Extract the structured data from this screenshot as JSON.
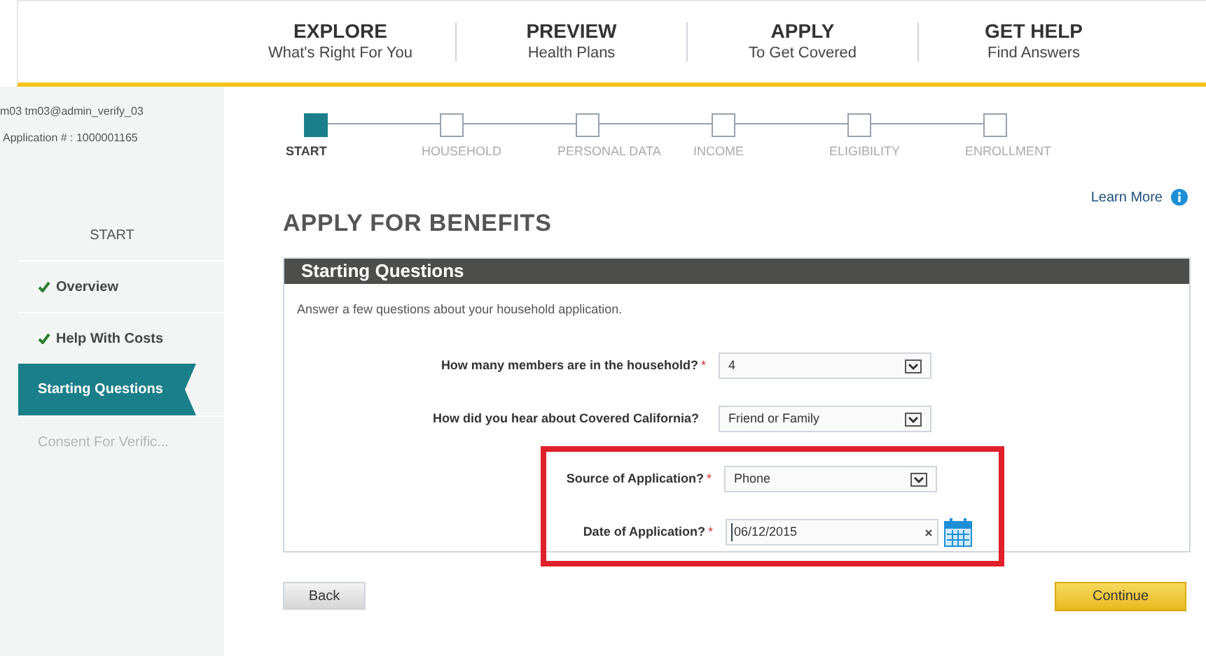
{
  "nav": [
    {
      "title": "EXPLORE",
      "subtitle": "What's Right For You"
    },
    {
      "title": "PREVIEW",
      "subtitle": "Health Plans"
    },
    {
      "title": "APPLY",
      "subtitle": "To Get Covered"
    },
    {
      "title": "GET HELP",
      "subtitle": "Find Answers"
    }
  ],
  "user": {
    "name": "m03 tm03@admin_verify_03",
    "application": "Application # : 1000001165"
  },
  "sidebar": {
    "heading": "START",
    "items": [
      {
        "label": "Overview",
        "completed": true,
        "selected": false,
        "disabled": false
      },
      {
        "label": "Help With Costs",
        "completed": true,
        "selected": false,
        "disabled": false
      },
      {
        "label": "Starting Questions",
        "completed": false,
        "selected": true,
        "disabled": false
      },
      {
        "label": "Consent For Verific...",
        "completed": false,
        "selected": false,
        "disabled": true
      }
    ]
  },
  "steps": [
    {
      "label": "START",
      "selected": true
    },
    {
      "label": "HOUSEHOLD",
      "selected": false
    },
    {
      "label": "PERSONAL DATA",
      "selected": false
    },
    {
      "label": "INCOME",
      "selected": false
    },
    {
      "label": "ELIGIBILITY",
      "selected": false
    },
    {
      "label": "ENROLLMENT",
      "selected": false
    }
  ],
  "learn_more": "Learn More",
  "title": "APPLY FOR BENEFITS",
  "panel": {
    "heading": "Starting Questions",
    "intro": "Answer a few questions about your household application.",
    "questions": [
      {
        "kind": "select",
        "label": "How many members are in the household?",
        "required_mark": "*",
        "value": "4",
        "highlighted": false
      },
      {
        "kind": "select",
        "label": "How did you hear about Covered California?",
        "value": "Friend or Family",
        "highlighted": false
      },
      {
        "kind": "select",
        "label": "Source of Application?",
        "required_mark": "*",
        "value": "Phone",
        "highlighted": true
      },
      {
        "kind": "date",
        "label": "Date of Application?",
        "required_mark": "*",
        "value": "06/12/2015",
        "highlighted": true
      }
    ]
  },
  "buttons": {
    "back": "Back",
    "continue": "Continue"
  }
}
